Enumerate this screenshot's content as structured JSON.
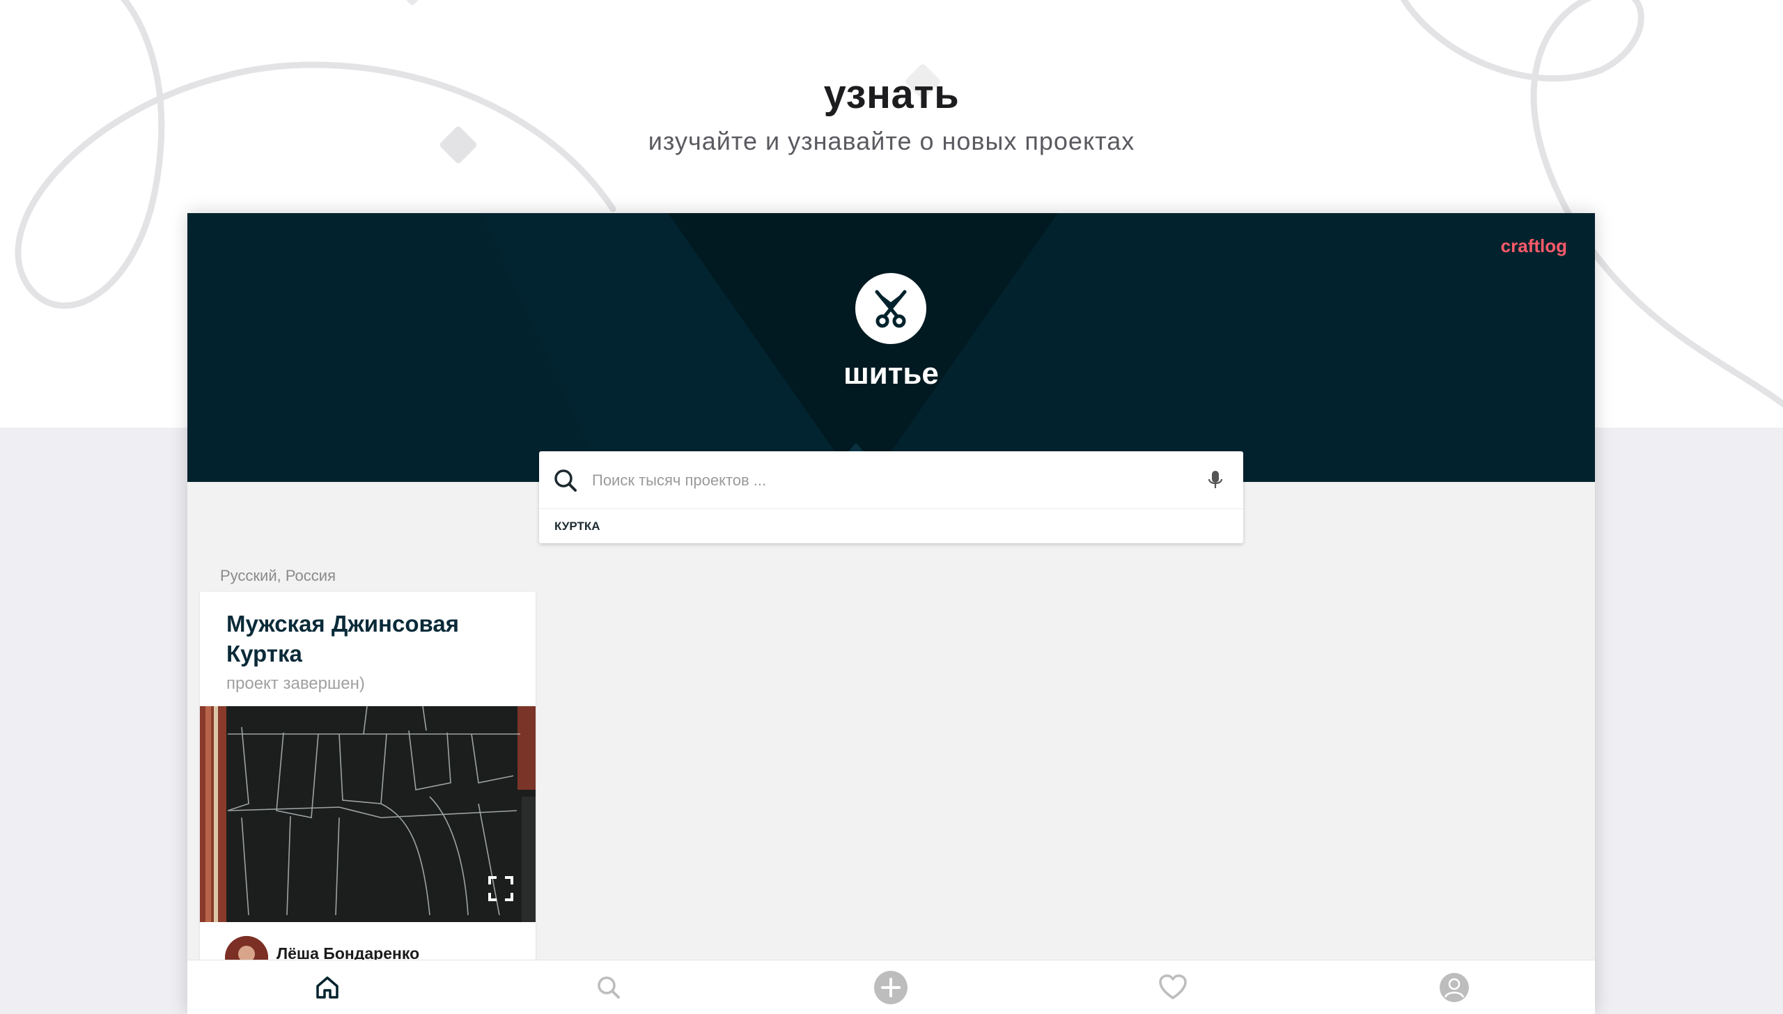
{
  "promo": {
    "title": "узнать",
    "subtitle": "изучайте и узнавайте о новых проектах"
  },
  "app": {
    "brand": "craftlog",
    "category_icon": "scissors-icon",
    "category_title": "шитье",
    "colors": {
      "hero_bg": "#02232d",
      "brand": "#ff5a6a",
      "page_bg": "#f2f2f2"
    }
  },
  "search": {
    "placeholder": "Поиск тысяч проектов ...",
    "value": "",
    "suggestions": [
      "КУРТКА"
    ]
  },
  "feed": {
    "locale": "Русский, Россия",
    "cards": [
      {
        "title": "Мужская Джинсовая Куртка",
        "status": "проект завершен)",
        "author": "Лёша Бондаренко"
      }
    ]
  },
  "bottom_nav": {
    "items": [
      {
        "icon": "home-icon",
        "active": true
      },
      {
        "icon": "search-icon",
        "active": false
      },
      {
        "icon": "add-icon",
        "active": false
      },
      {
        "icon": "heart-icon",
        "active": false
      },
      {
        "icon": "profile-icon",
        "active": false
      }
    ]
  }
}
